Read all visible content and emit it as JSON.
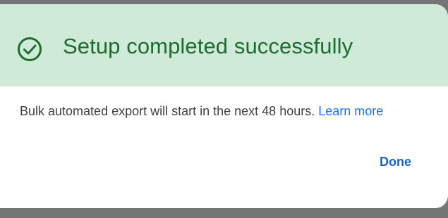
{
  "dialog": {
    "title": "Setup completed successfully",
    "message": "Bulk automated export will start in the next 48 hours.",
    "link_label": "Learn more",
    "done_label": "Done",
    "icon": "check-circle-icon",
    "colors": {
      "header_bg": "#cfead6",
      "title": "#1e6b34",
      "link": "#1a73e8",
      "done": "#1a5fc4"
    }
  }
}
